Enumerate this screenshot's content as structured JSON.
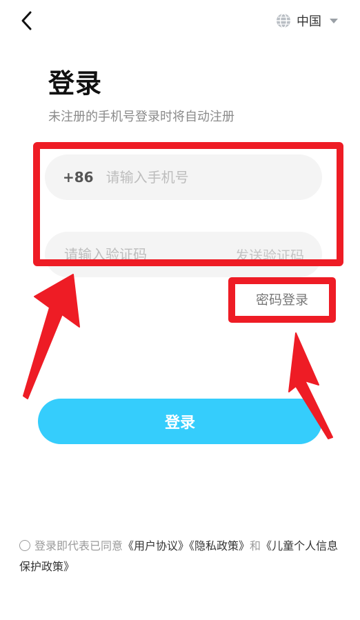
{
  "region": {
    "label": "中国",
    "icon": "globe-icon"
  },
  "header": {
    "back_icon": "back-arrow-icon"
  },
  "main": {
    "title": "登录",
    "subtitle": "未注册的手机号登录时将自动注册",
    "phone": {
      "country_code": "+86",
      "placeholder": "请输入手机号",
      "value": ""
    },
    "code": {
      "placeholder": "请输入验证码",
      "value": "",
      "send_label": "发送验证码"
    },
    "password_login_label": "密码登录",
    "login_button": "登录"
  },
  "agreement": {
    "prefix": "登录即代表已同意",
    "user_agreement": "《用户协议》",
    "privacy_policy": "《隐私政策》",
    "and": "和",
    "child_policy": "《儿童个人信息保护政策》"
  },
  "annotation": {
    "color": "#ee1c25"
  },
  "colors": {
    "accent": "#35cdfc",
    "field_bg": "#f4f4f4"
  }
}
